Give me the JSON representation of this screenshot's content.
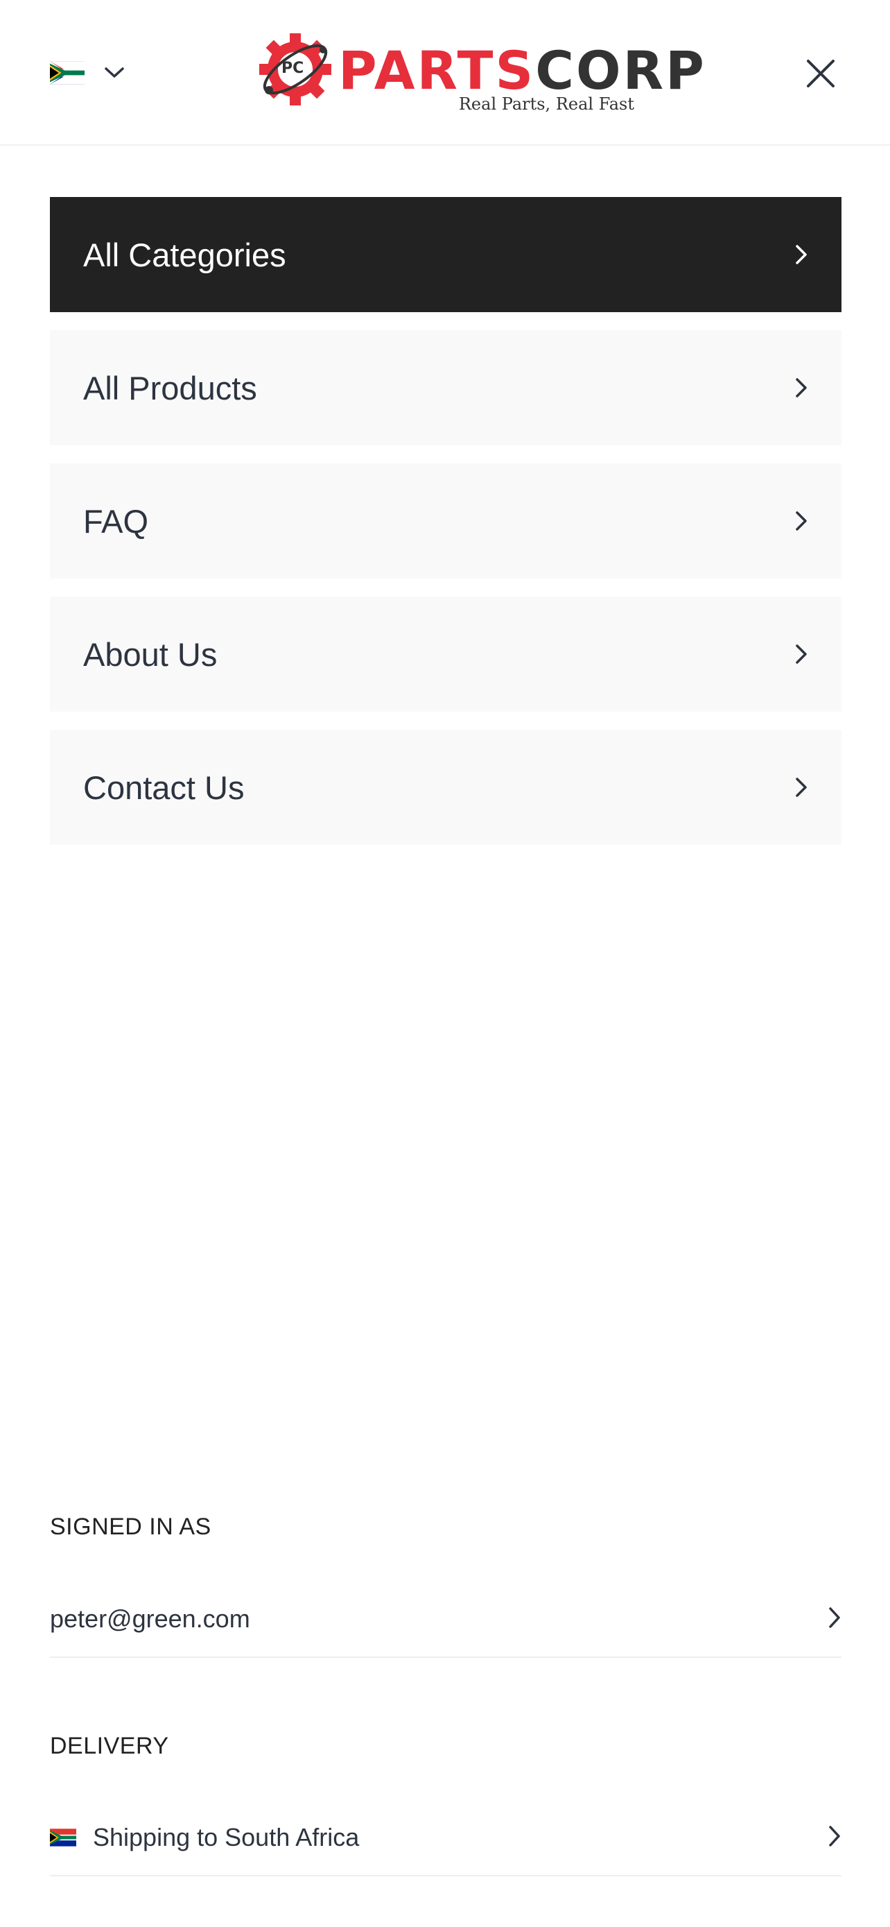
{
  "header": {
    "country_flag": "south-africa-flag-icon",
    "country_dropdown_icon": "chevron-down-icon",
    "logo": {
      "badge_text": "PC",
      "word_part1": "PARTS",
      "word_part2": "CORP",
      "tagline": "Real Parts, Real Fast"
    },
    "close_icon": "close-icon"
  },
  "menu": {
    "items": [
      {
        "label": "All Categories",
        "active": true
      },
      {
        "label": "All Products",
        "active": false
      },
      {
        "label": "FAQ",
        "active": false
      },
      {
        "label": "About Us",
        "active": false
      },
      {
        "label": "Contact Us",
        "active": false
      }
    ]
  },
  "account": {
    "title": "SIGNED IN AS",
    "email": "peter@green.com"
  },
  "delivery": {
    "title": "DELIVERY",
    "shipping_text": "Shipping to South Africa"
  },
  "colors": {
    "brand_red": "#e62f3b",
    "brand_dark": "#333333",
    "active_bg": "#222222",
    "item_bg": "#f9f9f9",
    "text": "#2d3440"
  }
}
